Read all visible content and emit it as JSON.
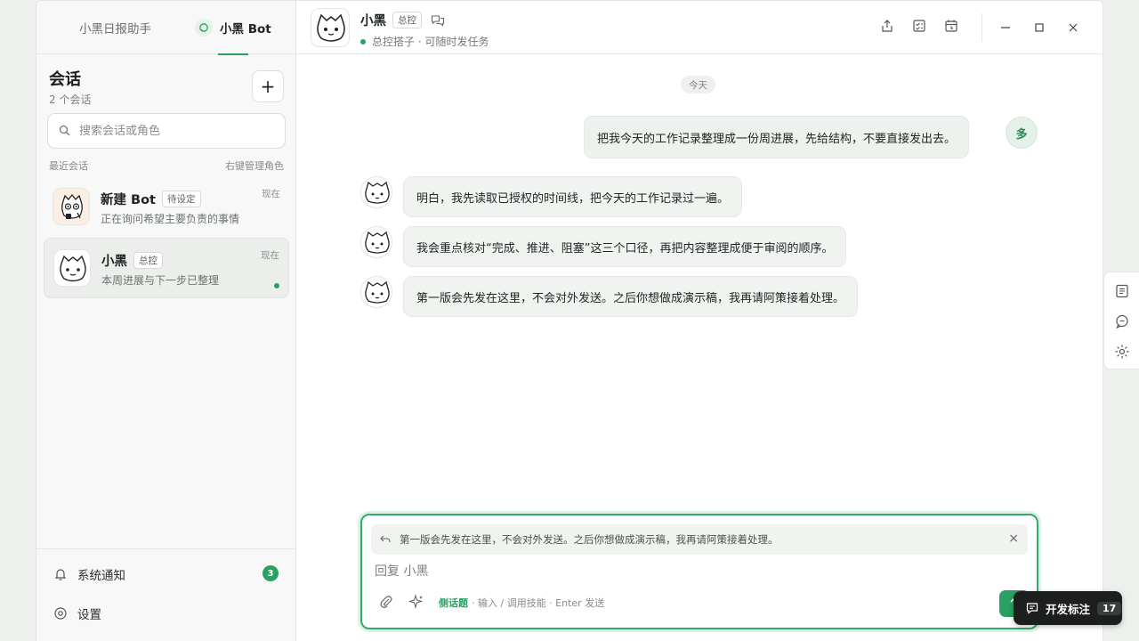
{
  "sidebar": {
    "tabs": [
      {
        "label": "小黑日报助手"
      },
      {
        "label": "小黑 Bot"
      }
    ],
    "title": "会话",
    "count": "2 个会话",
    "add_label": "+",
    "search": {
      "placeholder": "搜索会话或角色"
    },
    "recent_label": "最近会话",
    "manage_hint": "右键管理角色",
    "conversations": [
      {
        "name": "新建 Bot",
        "tag": "待设定",
        "preview": "正在询问希望主要负责的事情",
        "time": "现在"
      },
      {
        "name": "小黑",
        "tag": "总控",
        "preview": "本周进展与下一步已整理",
        "time": "现在"
      }
    ],
    "footer": {
      "notify_label": "系统通知",
      "notify_count": "3",
      "settings_label": "设置"
    }
  },
  "header": {
    "name": "小黑",
    "tag": "总控",
    "subtitle": "总控搭子 · 可随时发任务"
  },
  "chat": {
    "day_label": "今天",
    "user_avatar": "多",
    "user_message": "把我今天的工作记录整理成一份周进展，先给结构，不要直接发出去。",
    "bot_messages": [
      "明白，我先读取已授权的时间线，把今天的工作记录过一遍。",
      "我会重点核对“完成、推进、阻塞”这三个口径，再把内容整理成便于审阅的顺序。",
      "第一版会先发在这里，不会对外发送。之后你想做成演示稿，我再请阿策接着处理。"
    ]
  },
  "composer": {
    "reply_quote": "第一版会先发在这里，不会对外发送。之后你想做成演示稿，我再请阿策接着处理。",
    "placeholder": "回复 小黑",
    "hint_key": "侧话题",
    "hint_rest": "· 输入 / 调用技能 · Enter 发送"
  },
  "dev_badge": {
    "label": "开发标注",
    "count": "17"
  },
  "colors": {
    "accent": "#2aa062",
    "accent_soft": "#e3f1e8",
    "badge_dark": "#1c1f1d"
  }
}
